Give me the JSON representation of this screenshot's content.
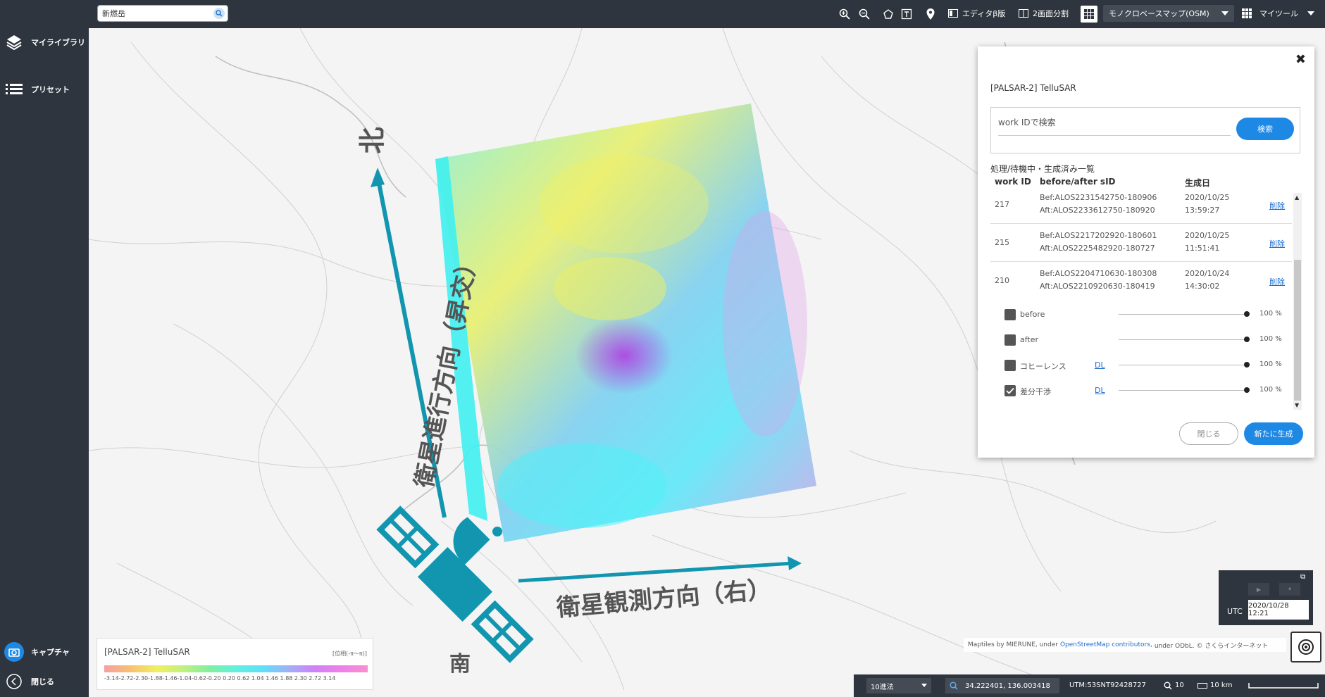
{
  "search": {
    "value": "新燃岳"
  },
  "sidebar": {
    "items": [
      {
        "label": "マイライブラリ"
      },
      {
        "label": "プリセット"
      }
    ],
    "bottom": [
      {
        "label": "キャプチャ"
      },
      {
        "label": "閉じる"
      }
    ]
  },
  "toolbar": {
    "editor_label": "エディタβ版",
    "split_label": "2画面分割",
    "basemap_value": "モノクロベースマップ(OSM)",
    "mytool_label": "マイツール"
  },
  "map": {
    "label_north": "北",
    "label_south": "南",
    "label_track": "衛星進行方向（昇交）",
    "label_look": "衛星観測方向（右）"
  },
  "panel": {
    "title": "[PALSAR-2] TelluSAR",
    "search_placeholder": "work IDで検索",
    "search_button": "検索",
    "list_label": "処理/待機中・生成済み一覧",
    "columns": [
      "work ID",
      "before/after sID",
      "生成日"
    ],
    "rows": [
      {
        "id": "217",
        "before": "Bef:ALOS2231542750-180906",
        "after": "Aft:ALOS2233612750-180920",
        "date": "2020/10/25",
        "time": "13:59:27",
        "action": "削除"
      },
      {
        "id": "215",
        "before": "Bef:ALOS2217202920-180601",
        "after": "Aft:ALOS2225482920-180727",
        "date": "2020/10/25",
        "time": "11:51:41",
        "action": "削除"
      },
      {
        "id": "210",
        "before": "Bef:ALOS2204710630-180308",
        "after": "Aft:ALOS2210920630-180419",
        "date": "2020/10/24",
        "time": "14:30:02",
        "action": "削除"
      }
    ],
    "layers": [
      {
        "name": "before",
        "checked": false,
        "dl": "",
        "opacity": "100 %"
      },
      {
        "name": "after",
        "checked": false,
        "dl": "",
        "opacity": "100 %"
      },
      {
        "name": "コヒーレンス",
        "checked": false,
        "dl": "DL",
        "opacity": "100 %"
      },
      {
        "name": "差分干渉",
        "checked": true,
        "dl": "DL",
        "opacity": "100 %"
      }
    ],
    "close_button": "閉じる",
    "new_button": "新たに生成"
  },
  "legend": {
    "title": "[PALSAR-2] TelluSAR",
    "unit": "[位相(-π～π)]",
    "ticks": "-3.14-2.72-2.30-1.88-1.46-1.04-0.62-0.20 0.20 0.62 1.04 1.46 1.88 2.30 2.72 3.14"
  },
  "time": {
    "zone": "UTC",
    "value": "2020/10/28 12:21"
  },
  "attribution": {
    "pre": "Maptiles by MIERUNE, under",
    "link": "OpenStreetMap contributors,",
    "post": "under ODbL. © さくらインターネット"
  },
  "status": {
    "notation": "10進法",
    "coords": "34.222401, 136.003418",
    "utm": "UTM:53SNT92428727",
    "zoom": "10",
    "scale": "10 km"
  },
  "colors": {
    "accent": "#1e88e5",
    "dark": "#2f353e",
    "teal": "#1296b0"
  }
}
